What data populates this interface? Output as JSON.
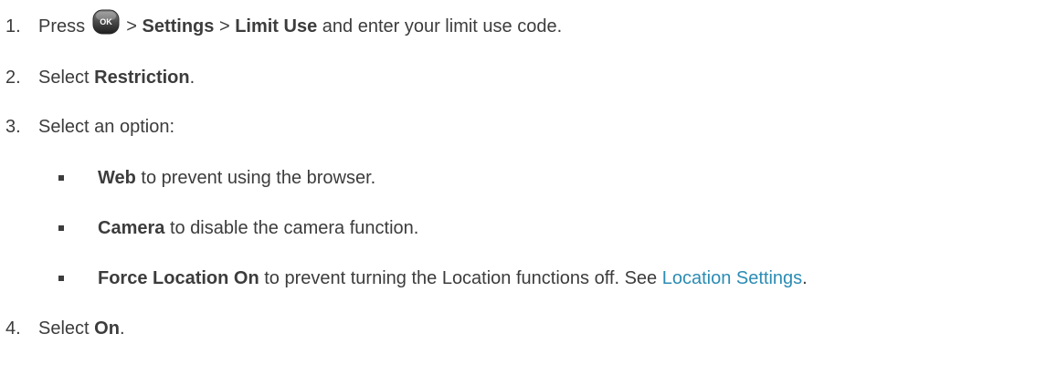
{
  "steps": [
    {
      "num": "1.",
      "pre": "Press",
      "icon": "ok-key-icon",
      "sep1": " > ",
      "b1": "Settings",
      "sep2": " > ",
      "b2": "Limit Use",
      "post": " and enter your limit use code."
    },
    {
      "num": "2.",
      "pre": "Select ",
      "b1": "Restriction",
      "post": "."
    },
    {
      "num": "3.",
      "text": "Select an option:"
    },
    {
      "num": "4.",
      "pre": "Select ",
      "b1": "On",
      "post": "."
    }
  ],
  "options": [
    {
      "b": "Web",
      "text": " to prevent using the browser."
    },
    {
      "b": "Camera",
      "text": " to disable the camera function."
    },
    {
      "b": "Force Location On",
      "text": " to prevent turning the Location functions off. See ",
      "link": "Location Settings",
      "end": "."
    }
  ],
  "ok_key_label": "OK"
}
